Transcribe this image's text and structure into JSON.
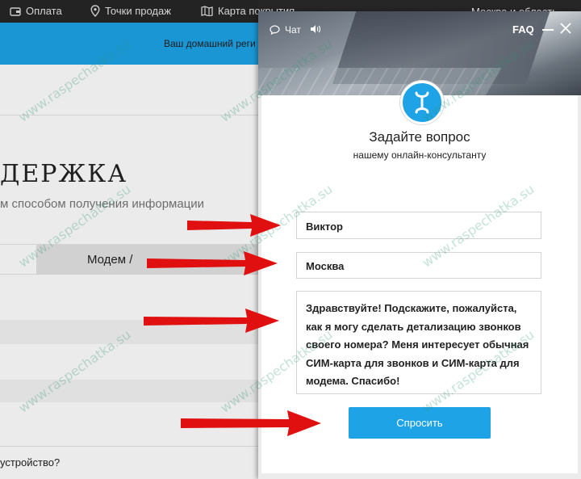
{
  "topbar": {
    "items": [
      {
        "label": "Оплата",
        "icon": "wallet-icon"
      },
      {
        "label": "Точки продаж",
        "icon": "location-pin-icon"
      },
      {
        "label": "Карта покрытия",
        "icon": "map-icon"
      }
    ],
    "region_label": "Москва и область"
  },
  "bluebar": {
    "text": "Ваш домашний реги"
  },
  "background_page": {
    "heading": "ДЕРЖКА",
    "subtitle": "м способом получения информации",
    "tab_label": "Модем /",
    "last_question": "устройство?"
  },
  "panel": {
    "chat_label": "Чат",
    "faq_label": "FAQ",
    "title": "Задайте вопрос",
    "subtitle": "нашему онлайн-консультанту",
    "fields": {
      "name_value": "Виктор",
      "city_value": "Москва",
      "message_value": "Здравствуйте! Подскажите, пожалуйста, как я могу сделать детализацию звонков своего номера? Меня интересует обычная СИМ-карта для звонков и СИМ-карта для модема. Спасибо!"
    },
    "submit_label": "Спросить"
  },
  "watermark": "www.raspechatka.su",
  "colors": {
    "brand_blue": "#1ea3e6",
    "top_bar": "#262626",
    "arrow_red": "#e01010"
  }
}
